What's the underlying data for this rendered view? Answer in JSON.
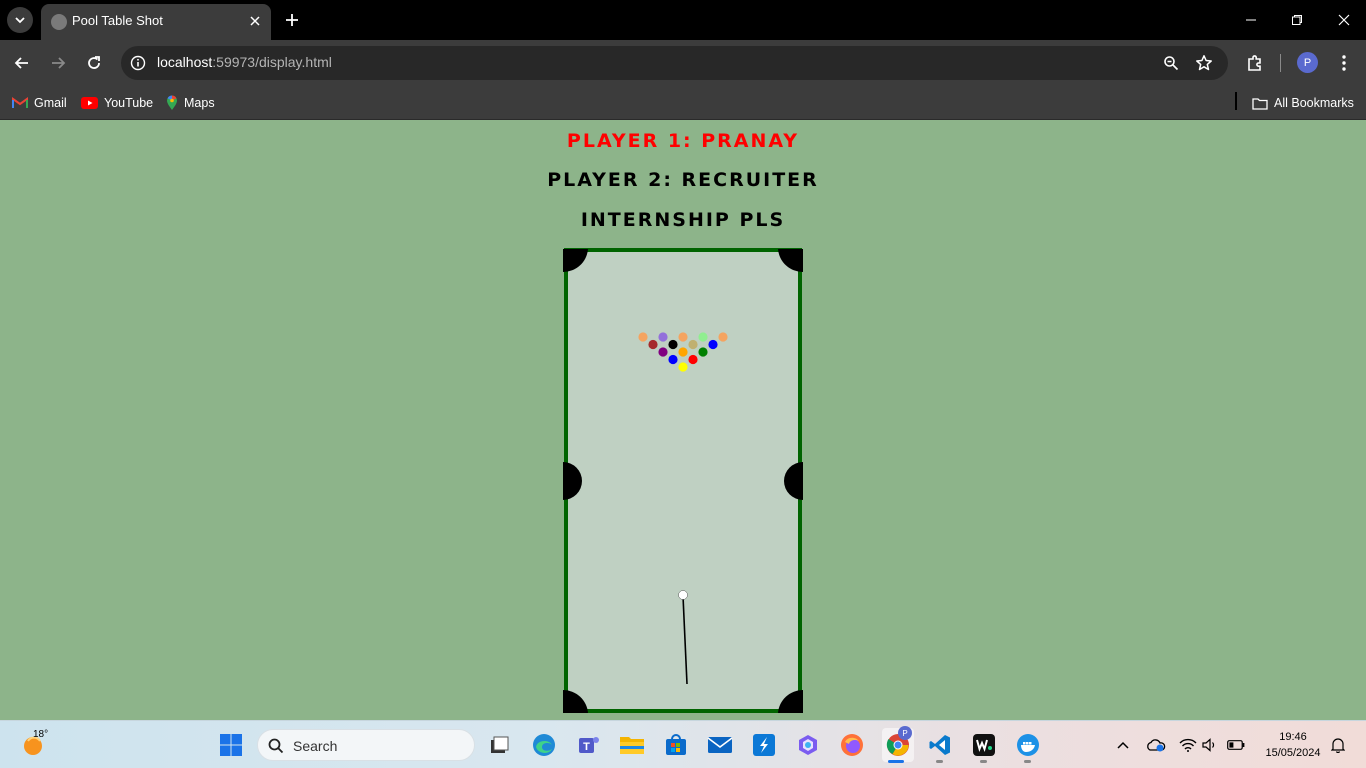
{
  "browser": {
    "tab_title": "Pool Table Shot",
    "url_host": "localhost",
    "url_rest": ":59973/display.html",
    "profile_initial": "P",
    "bookmarks": [
      {
        "label": "Gmail",
        "icon": "gmail-icon"
      },
      {
        "label": "YouTube",
        "icon": "youtube-icon"
      },
      {
        "label": "Maps",
        "icon": "maps-icon"
      }
    ],
    "all_bookmarks_label": "All Bookmarks"
  },
  "page": {
    "player1": "PLAYER 1: PRANAY",
    "player2": "PLAYER 2: RECRUITER",
    "message": "INTERNSHIP PLS"
  },
  "table": {
    "felt_color": "#bfd0c2",
    "rail_color": "#006400",
    "pocket_color": "#000000",
    "cue_ball_color": "#ffffff",
    "balls": [
      {
        "color": "#f4a460"
      },
      {
        "color": "#9370db"
      },
      {
        "color": "#f4a460"
      },
      {
        "color": "#90ee90"
      },
      {
        "color": "#f4a460"
      },
      {
        "color": "#a52a2a"
      },
      {
        "color": "#000000"
      },
      {
        "color": "#c0b070"
      },
      {
        "color": "#0000ff"
      },
      {
        "color": "#800080"
      },
      {
        "color": "#ffa500"
      },
      {
        "color": "#008000"
      },
      {
        "color": "#0000ff"
      },
      {
        "color": "#ff0000"
      },
      {
        "color": "#ffff00"
      }
    ]
  },
  "taskbar": {
    "weather_temp": "18°",
    "search_placeholder": "Search",
    "time": "19:46",
    "date": "15/05/2024"
  }
}
